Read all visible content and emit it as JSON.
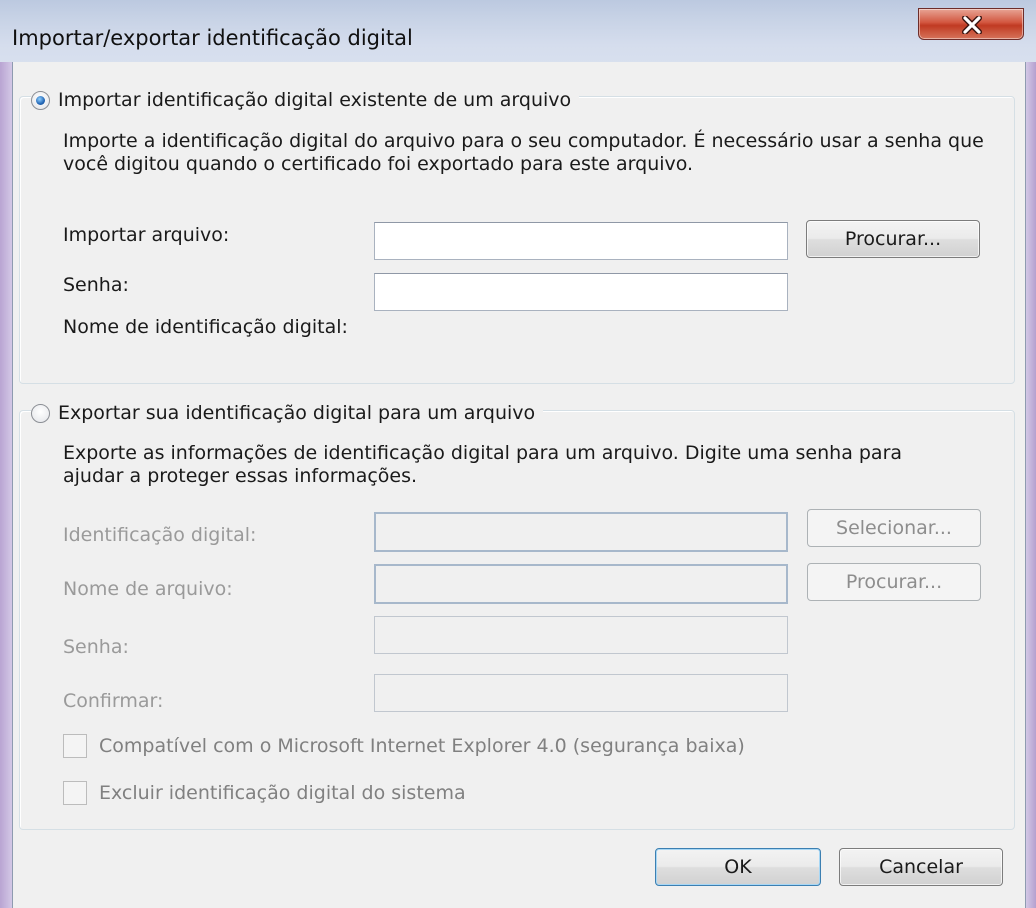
{
  "window": {
    "title": "Importar/exportar identificação digital",
    "close_glyph": "X"
  },
  "import_section": {
    "legend": "Importar identificação digital existente de um arquivo",
    "selected": true,
    "description": "Importe a identificação digital do arquivo para o seu computador. É necessário usar a senha que você digitou quando o certificado foi exportado para este arquivo.",
    "file_label": "Importar arquivo:",
    "file_value": "",
    "browse_label": "Procurar...",
    "password_label": "Senha:",
    "password_value": "",
    "name_label": "Nome de identificação digital:",
    "name_value": ""
  },
  "export_section": {
    "legend": "Exportar sua identificação digital para um arquivo",
    "selected": false,
    "description": "Exporte as informações de identificação digital para um arquivo. Digite uma senha para ajudar a proteger essas informações.",
    "id_label": "Identificação digital:",
    "id_value": "",
    "select_label": "Selecionar...",
    "filename_label": "Nome de arquivo:",
    "filename_value": "",
    "browse_label": "Procurar...",
    "password_label": "Senha:",
    "password_value": "",
    "confirm_label": "Confirmar:",
    "confirm_value": "",
    "ie4_checkbox_label": "Compatível com o Microsoft Internet Explorer 4.0 (segurança baixa)",
    "ie4_checked": false,
    "delete_checkbox_label": "Excluir identificação digital do sistema",
    "delete_checked": false
  },
  "footer": {
    "ok_label": "OK",
    "cancel_label": "Cancelar"
  },
  "colors": {
    "dialog_bg": "#f0f0f0",
    "close_button": "#c03a22",
    "disabled_text": "#9a9a9a",
    "default_button_border": "#3c7fb1"
  },
  "icons": {
    "close": "close-icon",
    "import_radio": "radio-checked-icon",
    "export_radio": "radio-unchecked-icon"
  }
}
